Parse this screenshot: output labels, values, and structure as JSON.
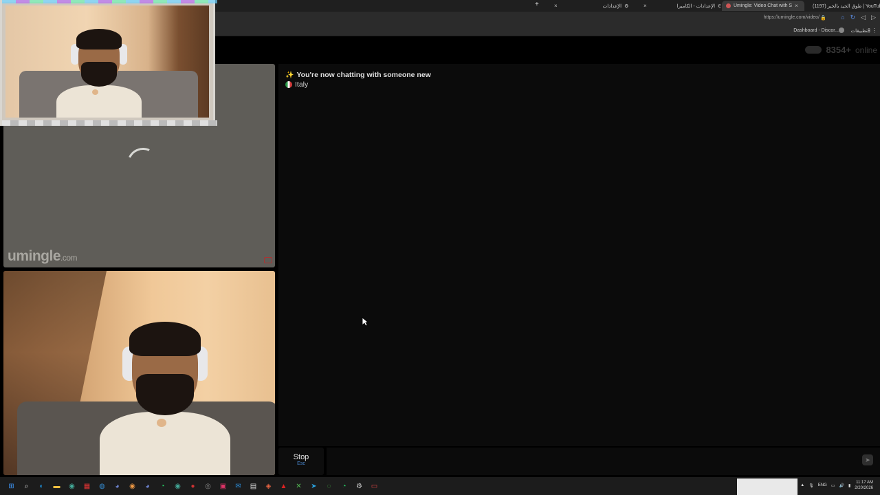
{
  "browser": {
    "tabs": [
      {
        "title": "(1197) طوق الحيد بالخير | YouTube",
        "favicon_color": "#e22a2a"
      },
      {
        "title": "Umingle: Video Chat with S",
        "favicon_color": "#cc5555"
      },
      {
        "title": "الإعدادات - الكاميرا",
        "favicon_color": "#aaaaaa"
      },
      {
        "title": "الإعدادات",
        "favicon_color": "#aaaaaa"
      }
    ],
    "new_tab": "+",
    "close": "×",
    "url": "https://umingle.com/video/",
    "bookmarks": {
      "left": "Dashboard - Discor...",
      "right": "التطبيقات"
    }
  },
  "header": {
    "online_count": "8354+",
    "online_label": "online"
  },
  "stranger_panel": {
    "brand": "umingle",
    "brand_domain": ".com"
  },
  "chat": {
    "status_message": "You're now chatting with someone new",
    "country": "Italy"
  },
  "controls": {
    "stop_label": "Stop",
    "stop_key": "Esc",
    "message_placeholder": ""
  },
  "taskbar": {
    "icons": [
      "windows-start",
      "search",
      "edge",
      "file-explorer",
      "chrome",
      "calendar",
      "browser",
      "discord",
      "chrome-2",
      "discord-2",
      "whatsapp",
      "chrome-3",
      "app",
      "obs",
      "instagram",
      "mail",
      "notes",
      "firefox",
      "adobe",
      "xbox",
      "telegram",
      "app-2",
      "whatsapp-2",
      "settings",
      "mail-2"
    ],
    "language": "ENG",
    "time": "11:17 AM",
    "date": "2/20/2026"
  },
  "colors": {
    "accent": "#4a8bd6",
    "background": "#000000",
    "chat_bg": "#0b0b0b",
    "stranger_bg": "#5f5d58"
  }
}
